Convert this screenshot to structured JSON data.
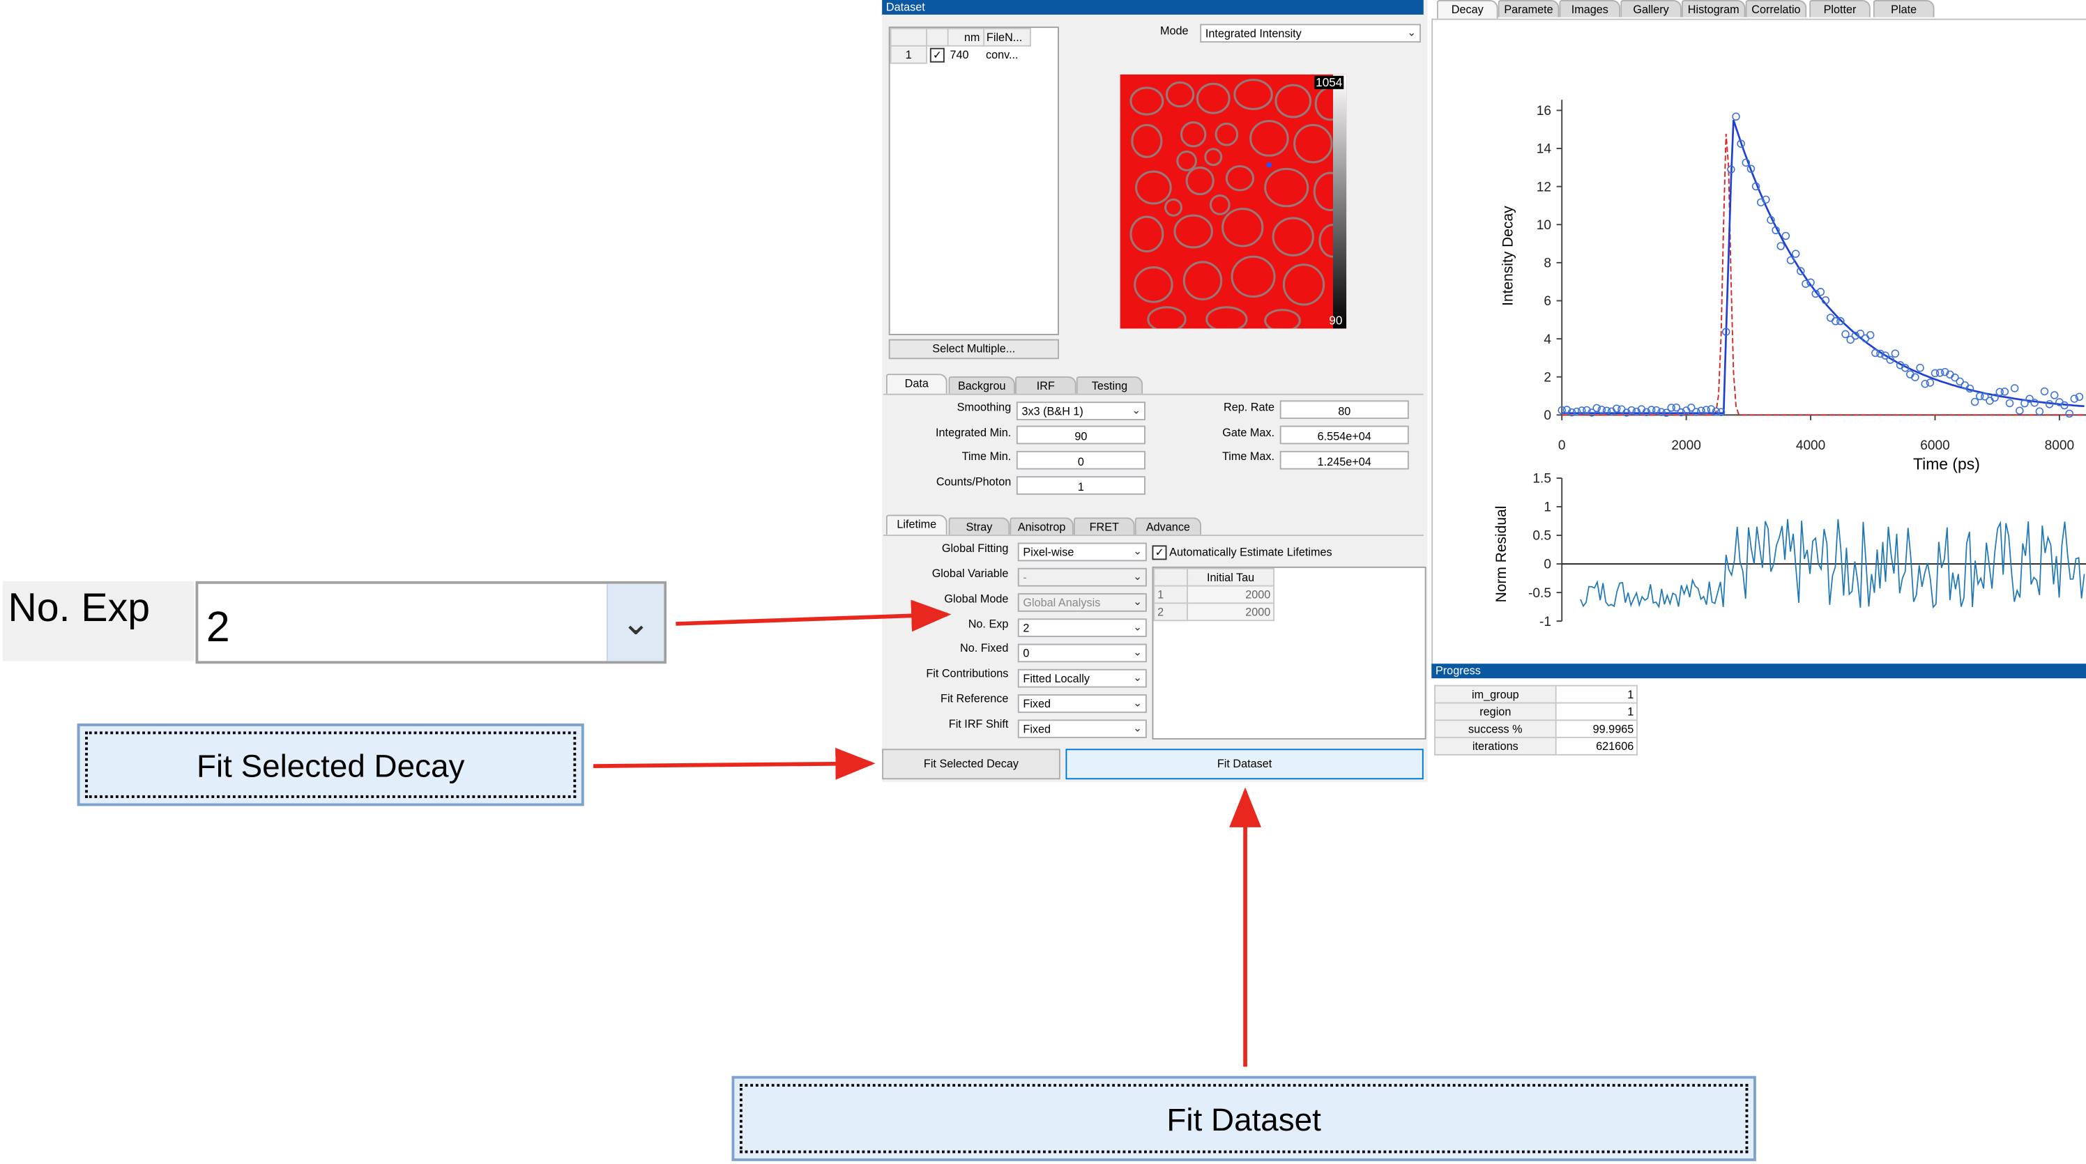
{
  "zoom": {
    "no_exp_label": "No. Exp",
    "no_exp_value": "2",
    "fit_selected_label": "Fit Selected Decay",
    "fit_dataset_label": "Fit Dataset"
  },
  "dataset": {
    "title": "Dataset",
    "table_headers": [
      "",
      "",
      "nm",
      "FileN..."
    ],
    "row": {
      "index": "1",
      "checked": true,
      "nm": "740",
      "file": "conv..."
    },
    "select_multiple": "Select Multiple...",
    "mode_label": "Mode",
    "mode_value": "Integrated Intensity",
    "colorbar_max": "1054",
    "colorbar_min": "90"
  },
  "data_tabs": [
    "Data",
    "Backgrou",
    "IRF",
    "Testing"
  ],
  "data_fields": {
    "smoothing_label": "Smoothing",
    "smoothing_value": "3x3 (B&H 1)",
    "integrated_min_label": "Integrated Min.",
    "integrated_min_value": "90",
    "time_min_label": "Time Min.",
    "time_min_value": "0",
    "counts_photon_label": "Counts/Photon",
    "counts_photon_value": "1",
    "rep_rate_label": "Rep. Rate",
    "rep_rate_value": "80",
    "gate_max_label": "Gate Max.",
    "gate_max_value": "6.554e+04",
    "time_max_label": "Time Max.",
    "time_max_value": "1.245e+04"
  },
  "lifetime_tabs": [
    "Lifetime",
    "Stray",
    "Anisotrop",
    "FRET",
    "Advance"
  ],
  "lifetime": {
    "global_fitting_label": "Global Fitting",
    "global_fitting_value": "Pixel-wise",
    "global_variable_label": "Global Variable",
    "global_variable_value": "-",
    "global_mode_label": "Global Mode",
    "global_mode_value": "Global Analysis",
    "no_exp_label": "No. Exp",
    "no_exp_value": "2",
    "no_fixed_label": "No. Fixed",
    "no_fixed_value": "0",
    "fit_contributions_label": "Fit Contributions",
    "fit_contributions_value": "Fitted Locally",
    "fit_reference_label": "Fit Reference",
    "fit_reference_value": "Fixed",
    "fit_irf_shift_label": "Fit IRF Shift",
    "fit_irf_shift_value": "Fixed",
    "auto_estimate_label": "Automatically Estimate Lifetimes",
    "tau_header": "Initial Tau",
    "tau_rows": [
      {
        "idx": "1",
        "value": "2000"
      },
      {
        "idx": "2",
        "value": "2000"
      }
    ]
  },
  "buttons": {
    "fit_selected": "Fit Selected Decay",
    "fit_dataset": "Fit Dataset"
  },
  "right_tabs": [
    "Decay",
    "Paramete",
    "Images",
    "Gallery",
    "Histogram",
    "Correlatio",
    "Plotter",
    "Plate"
  ],
  "decay_plot": {
    "ylabel": "Intensity Decay",
    "xlabel": "Time (ps)",
    "residual_ylabel": "Norm Residual",
    "x_ticks": [
      "0",
      "2000",
      "4000",
      "6000",
      "8000"
    ],
    "y_ticks": [
      "0",
      "2",
      "4",
      "6",
      "8",
      "10",
      "12",
      "14",
      "16"
    ],
    "res_ticks": [
      "1.5",
      "1",
      "0.5",
      "0",
      "-0.5",
      "-1"
    ]
  },
  "progress": {
    "title": "Progress",
    "rows": [
      {
        "key": "im_group",
        "value": "1"
      },
      {
        "key": "region",
        "value": "1"
      },
      {
        "key": "success %",
        "value": "99.9965"
      },
      {
        "key": "iterations",
        "value": "621606"
      }
    ]
  },
  "colors": {
    "title_bar": "#0a57a2",
    "arrow": "#e8281e",
    "fit_blue": "#1f3fd0",
    "irf_red": "#d62728",
    "zoom_button_bg": "#e3eefb"
  },
  "icons": {
    "dropdown": "chevron-down-icon",
    "checkbox": "checkbox-checked-icon"
  }
}
